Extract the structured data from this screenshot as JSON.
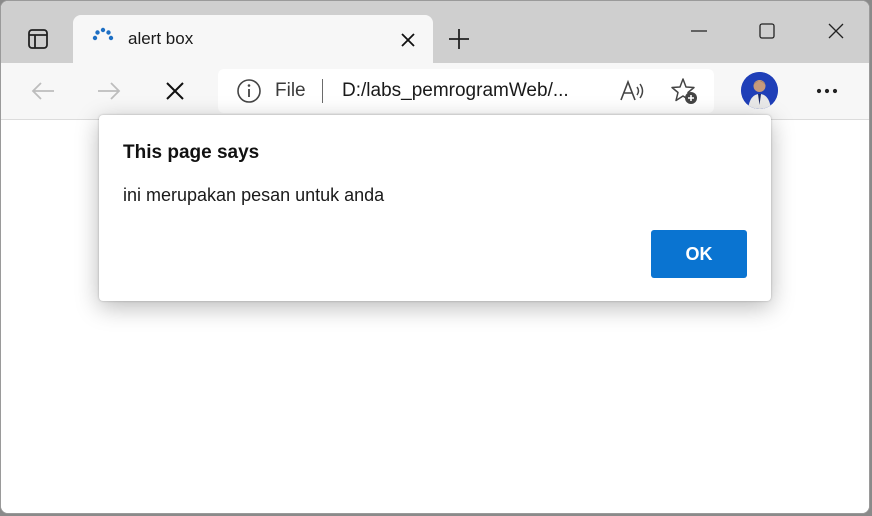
{
  "tab": {
    "title": "alert box"
  },
  "address": {
    "scheme_label": "File",
    "url": "D:/labs_pemrogramWeb/..."
  },
  "dialog": {
    "title": "This page says",
    "message": "ini merupakan pesan untuk anda",
    "ok_label": "OK"
  },
  "icons": {
    "workspaces": "tab-actions-icon",
    "spinner": "loading-spinner-icon",
    "tab_close": "close-icon",
    "new_tab": "plus-icon",
    "minimize": "minimize-icon",
    "maximize": "maximize-icon",
    "window_close": "close-icon",
    "back": "arrow-left-icon",
    "forward": "arrow-right-icon",
    "stop": "close-icon",
    "info": "info-icon",
    "read_aloud": "read-aloud-icon",
    "favorite": "star-add-icon",
    "more": "more-dots-icon"
  },
  "colors": {
    "accent": "#0a74d1",
    "titlebar": "#cfcfcf",
    "toolbar": "#f7f7f7"
  }
}
